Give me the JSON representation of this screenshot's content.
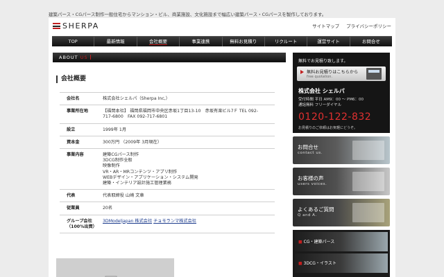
{
  "tagline": "建築パース・CGパース制作一般住宅からマンション・ビル、商業施設、文化施設まで幅広い建築パース・CGパースを製作しております。",
  "logo": "SHERPA",
  "util_links": [
    "サイトマップ",
    "プライバシーポリシー"
  ],
  "nav": [
    "TOP",
    "最新情報",
    "会社概要",
    "事業連携",
    "無料お見積り",
    "リクルート",
    "運営サイト",
    "お問合せ"
  ],
  "nav_active": "会社概要",
  "about_bar": {
    "en": "ABOUT",
    "us": "US"
  },
  "section_title": "会社概要",
  "info_rows": [
    {
      "label": "会社名",
      "lines": [
        "株式会社シェルパ（Sherpa Inc,）"
      ]
    },
    {
      "label": "事業所在地",
      "lines": [
        "【福岡本社】 福岡県福岡市中央区赤坂1丁目13-10　赤坂有楽ビル7Ｆ TEL 092-",
        "717-6800　FAX 092-717-6801"
      ]
    },
    {
      "label": "設立",
      "lines": [
        "1999年 1月"
      ]
    },
    {
      "label": "資本金",
      "lines": [
        "300万円 （2009年 3月現在）"
      ]
    },
    {
      "label": "事業内容",
      "lines": [
        "建築CGパース制作",
        "3DCG制作全般",
        "映像制作",
        "VR・AR・MRコンテンツ・アプリ制作",
        "WEBデザイン・アプリケーション・システム開発",
        "建築・インテリア設計施工管理業務"
      ]
    },
    {
      "label": "代表",
      "lines": [
        "代表取締役 山崎 文章"
      ]
    },
    {
      "label": "従業員",
      "lines": [
        "20名"
      ]
    }
  ],
  "group": {
    "label_line1": "グループ会社",
    "label_line2": "（100%出資）",
    "link1": "3DModeljapan 株式会社",
    "link2": "チョモランマ株式会社"
  },
  "sidebar": {
    "contact_head": "無料でお見積り致します。",
    "quote_line1": "無料お見積りはこちらから",
    "quote_line2": "free quotation.",
    "company": "株式会社 シェルパ",
    "hours_line1": "受付時間 平日 AM9：00 ～ PM6：00",
    "hours_line2": "通話無料 フリーダイヤル",
    "tel": "0120-122-832",
    "note": "お見積りのご依頼はお気軽にどうぞ。",
    "banners": [
      {
        "title": "お問合せ",
        "sub": "contact us."
      },
      {
        "title": "お客様の声",
        "sub": "users voices."
      },
      {
        "title": "よくあるご質問",
        "sub": "Q and A."
      }
    ],
    "cg_items": [
      "CG・建築パース",
      "3DCG・イラスト"
    ]
  }
}
